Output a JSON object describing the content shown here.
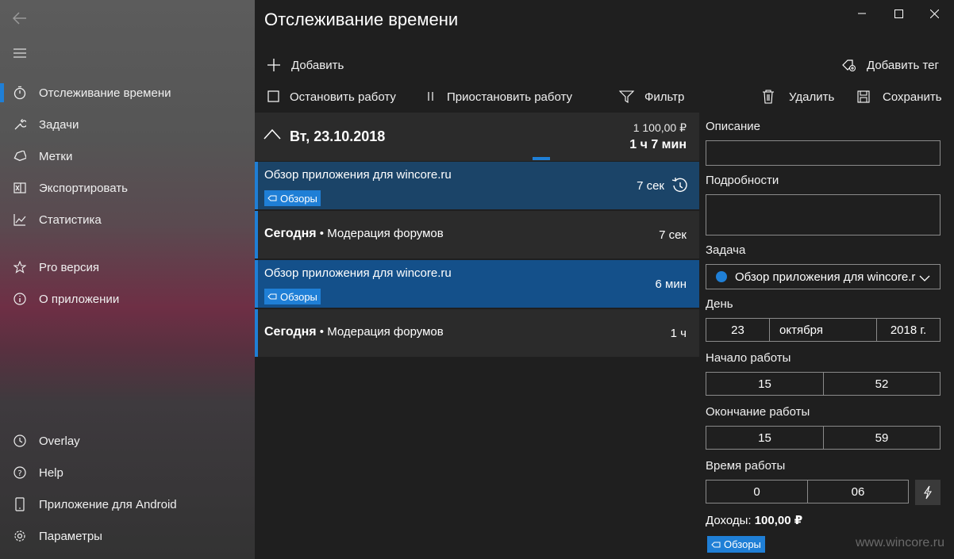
{
  "app": {
    "title": "Отслеживание времени"
  },
  "sidebar": {
    "items": [
      {
        "label": "Отслеживание времени",
        "icon": "stopwatch-icon"
      },
      {
        "label": "Задачи",
        "icon": "wrench-icon"
      },
      {
        "label": "Метки",
        "icon": "tag-icon"
      },
      {
        "label": "Экспортировать",
        "icon": "excel-icon"
      },
      {
        "label": "Статистика",
        "icon": "chart-icon"
      },
      {
        "label": "Pro версия",
        "icon": "star-icon"
      },
      {
        "label": "О приложении",
        "icon": "info-icon"
      }
    ],
    "bottom": [
      {
        "label": "Overlay",
        "icon": "overlay-icon"
      },
      {
        "label": "Help",
        "icon": "help-icon"
      },
      {
        "label": "Приложение для Android",
        "icon": "phone-icon"
      },
      {
        "label": "Параметры",
        "icon": "gear-icon"
      }
    ]
  },
  "toolbar": {
    "add": "Добавить",
    "add_tag": "Добавить тег",
    "stop": "Остановить работу",
    "pause": "Приостановить работу",
    "filter": "Фильтр",
    "delete": "Удалить",
    "save": "Сохранить"
  },
  "group": {
    "date": "Вт, 23.10.2018",
    "amount": "1 100,00 ₽",
    "duration": "1 ч 7 мин"
  },
  "entries": [
    {
      "name": "Обзор приложения для wincore.ru",
      "tag": "Обзоры",
      "time": "7 сек"
    },
    {
      "bold": "Сегодня",
      "sep": " • ",
      "task": "Модерация форумов",
      "time": "7 сек"
    },
    {
      "name": "Обзор приложения для wincore.ru",
      "tag": "Обзоры",
      "time": "6 мин"
    },
    {
      "bold": "Сегодня",
      "sep": " • ",
      "task": "Модерация форумов",
      "time": "1 ч"
    }
  ],
  "details": {
    "description_label": "Описание",
    "details_label": "Подробности",
    "task_label": "Задача",
    "task_value": "Обзор приложения для wincore.r",
    "day_label": "День",
    "day": "23",
    "month": "октября",
    "year": "2018 г.",
    "start_label": "Начало работы",
    "start_h": "15",
    "start_m": "52",
    "end_label": "Окончание работы",
    "end_h": "15",
    "end_m": "59",
    "work_label": "Время работы",
    "work_h": "0",
    "work_m": "06",
    "income_label": "Доходы:",
    "income_value": "100,00 ₽",
    "tag": "Обзоры"
  },
  "watermark": "www.wincore.ru",
  "colors": {
    "accent": "#1f7fd6",
    "selected": "#14508a"
  }
}
